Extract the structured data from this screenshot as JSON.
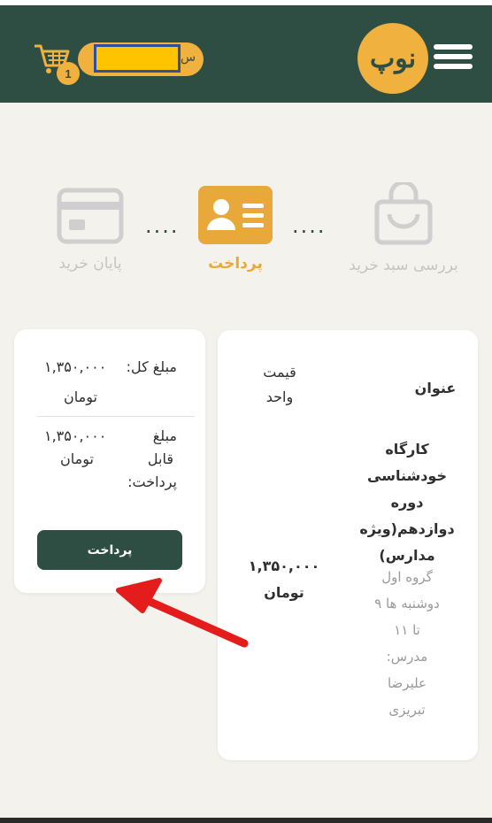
{
  "header": {
    "logo_text": "نوپ",
    "cart_count": "1",
    "user_initial": "س"
  },
  "steps": [
    {
      "label": "بررسی سبد خرید",
      "state": "inactive"
    },
    {
      "label": "پرداخت",
      "state": "active"
    },
    {
      "label": "پایان خرید",
      "state": "inactive"
    }
  ],
  "summary": {
    "total_label": "مبلغ کل:",
    "total_value": "۱,۳۵۰,۰۰۰",
    "total_currency": "تومان",
    "payable_label_1": "مبلغ",
    "payable_label_2": "قابل",
    "payable_label_3": "پرداخت:",
    "payable_value": "۱,۳۵۰,۰۰۰",
    "payable_currency": "تومان",
    "pay_button": "پرداخت"
  },
  "table": {
    "col_title": "عنوان",
    "col_price_1": "قیمت",
    "col_price_2": "واحد",
    "course_title_lines": [
      "کارگاه",
      "خودشناسی",
      "دوره",
      "دوازدهم(ویژه",
      "مدارس)"
    ],
    "course_meta_lines": [
      "گروه اول",
      "دوشنبه ها ۹",
      "تا ۱۱",
      "مدرس:",
      "علیرضا",
      "تبریزی"
    ],
    "price_value": "۱,۳۵۰,۰۰۰",
    "price_currency": "تومان"
  },
  "colors": {
    "header": "#2f4e43",
    "accent": "#f0b13e",
    "active_step": "#e8a93a",
    "inactive_step": "#cfcfcf",
    "arrow": "#e51c1c"
  }
}
